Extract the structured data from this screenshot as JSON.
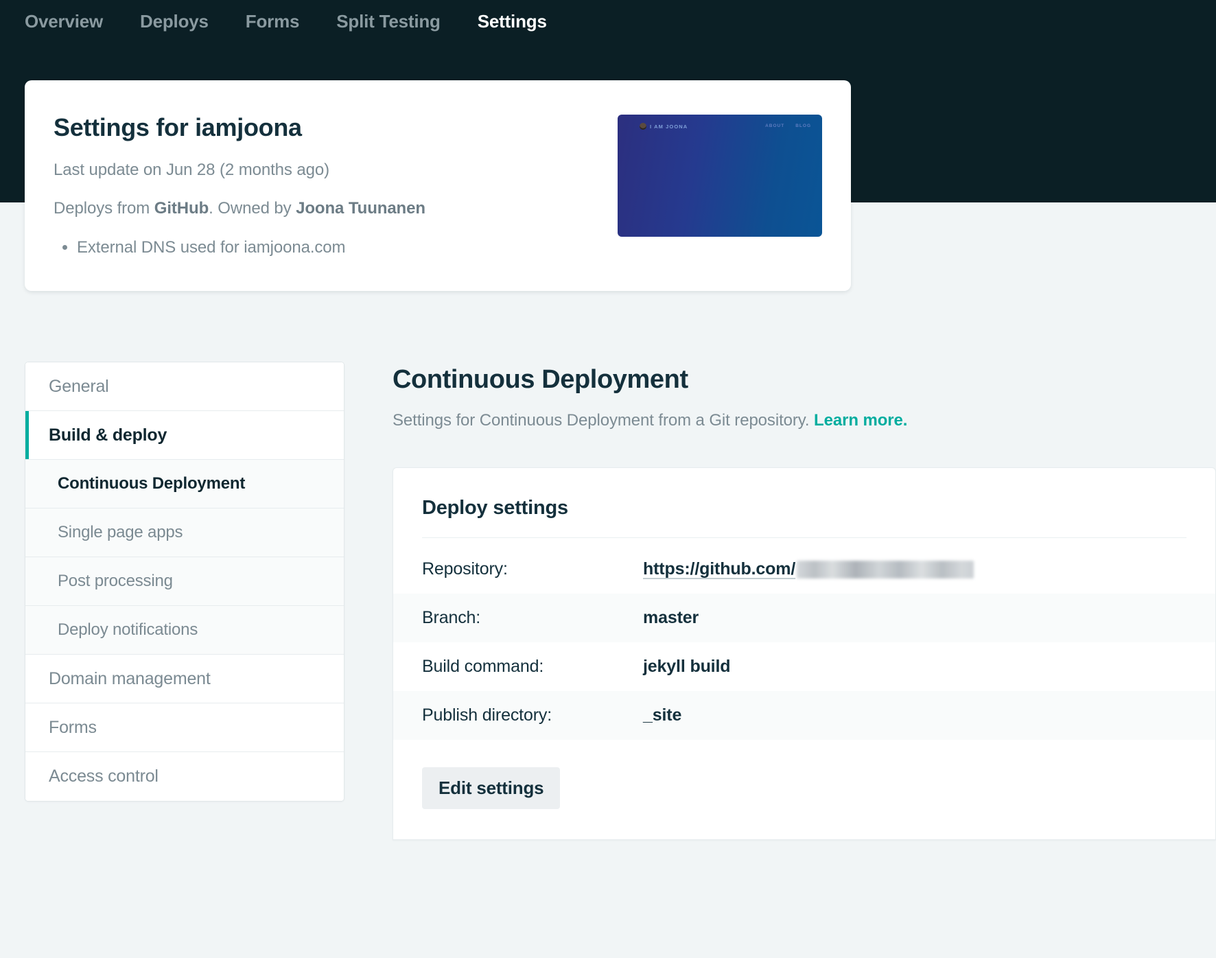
{
  "topnav": {
    "items": [
      {
        "label": "Overview",
        "active": false
      },
      {
        "label": "Deploys",
        "active": false
      },
      {
        "label": "Forms",
        "active": false
      },
      {
        "label": "Split Testing",
        "active": false
      },
      {
        "label": "Settings",
        "active": true
      }
    ]
  },
  "site_card": {
    "title": "Settings for iamjoona",
    "last_update": "Last update on Jun 28 (2 months ago)",
    "deploys_prefix": "Deploys from ",
    "deploys_source": "GitHub",
    "deploys_mid": ". Owned by ",
    "owner": "Joona Tuunanen",
    "bullets": [
      "External DNS used for iamjoona.com"
    ],
    "thumbnail": {
      "logo_text": "I AM JOONA",
      "nav": [
        "ABOUT",
        "BLOG"
      ],
      "gradient_from": "#2c2f7f",
      "gradient_to": "#0a5596"
    }
  },
  "settings_nav": {
    "items": [
      {
        "label": "General",
        "level": "top",
        "state": "default"
      },
      {
        "label": "Build & deploy",
        "level": "top",
        "state": "selected"
      },
      {
        "label": "Continuous Deployment",
        "level": "sub",
        "state": "active"
      },
      {
        "label": "Single page apps",
        "level": "sub",
        "state": "default"
      },
      {
        "label": "Post processing",
        "level": "sub",
        "state": "default"
      },
      {
        "label": "Deploy notifications",
        "level": "sub",
        "state": "default"
      },
      {
        "label": "Domain management",
        "level": "top",
        "state": "default"
      },
      {
        "label": "Forms",
        "level": "top",
        "state": "default"
      },
      {
        "label": "Access control",
        "level": "top",
        "state": "default"
      }
    ],
    "accent_color": "#00ad9f"
  },
  "main": {
    "heading": "Continuous Deployment",
    "subtitle_text": "Settings for Continuous Deployment from a Git repository. ",
    "subtitle_link": "Learn more.",
    "panel": {
      "title": "Deploy settings",
      "rows": [
        {
          "key": "Repository:",
          "value": "https://github.com/",
          "type": "link-redacted"
        },
        {
          "key": "Branch:",
          "value": "master",
          "type": "text"
        },
        {
          "key": "Build command:",
          "value": "jekyll build",
          "type": "text"
        },
        {
          "key": "Publish directory:",
          "value": "_site",
          "type": "text"
        }
      ],
      "edit_button": "Edit settings"
    }
  }
}
